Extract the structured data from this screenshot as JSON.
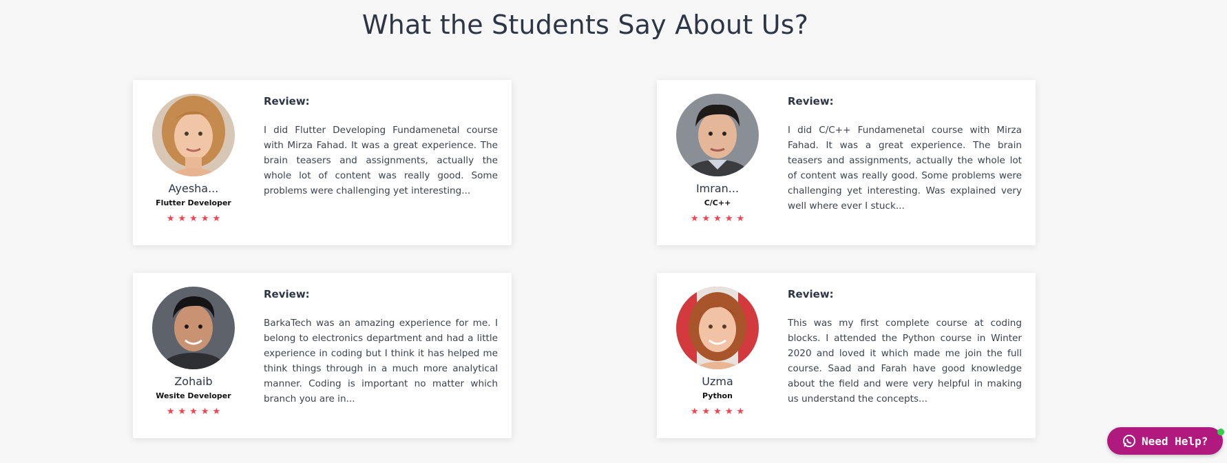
{
  "section": {
    "title": "What the Students Say About Us?"
  },
  "testimonials": [
    {
      "name": "Ayesha...",
      "role": "Flutter Developer",
      "rating": 5,
      "review_heading": "Review:",
      "review_text": "I did Flutter Developing Fundamenetal course with Mirza Fahad. It was a great experience. The brain teasers and assignments, actually the whole lot of content was really good. Some problems were challenging yet interesting..."
    },
    {
      "name": "Imran...",
      "role": "C/C++",
      "rating": 5,
      "review_heading": "Review:",
      "review_text": "I did C/C++ Fundamenetal course with Mirza Fahad. It was a great experience. The brain teasers and assignments, actually the whole lot of content was really good. Some problems were challenging yet interesting. Was explained very well where ever I stuck..."
    },
    {
      "name": "Zohaib",
      "role": "Wesite Developer",
      "rating": 5,
      "review_heading": "Review:",
      "review_text": "BarkaTech was an amazing experience for me. I belong to electronics department and had a little experience in coding but I think it has helped me think things through in a much more analytical manner. Coding is important no matter which branch you are in..."
    },
    {
      "name": "Uzma",
      "role": "Python",
      "rating": 5,
      "review_heading": "Review:",
      "review_text": "This was my first complete course at coding blocks. I attended the Python course in Winter 2020 and loved it which made me join the full course. Saad and Farah have good knowledge about the field and were very helpful in making us understand the concepts..."
    }
  ],
  "help_widget": {
    "label": "Need Help?",
    "icon": "whatsapp-icon",
    "status": "online"
  },
  "colors": {
    "star": "#f5424e",
    "help_button": "#b0197e",
    "online_dot": "#2fd14b",
    "heading": "#2c3646"
  }
}
